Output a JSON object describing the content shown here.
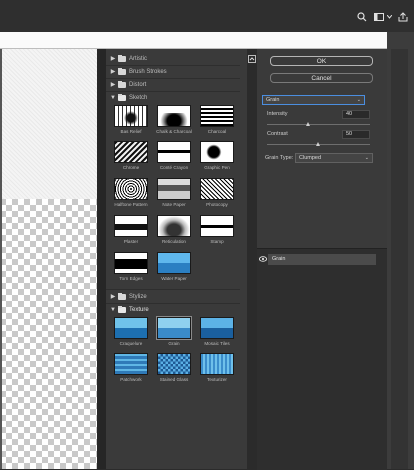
{
  "dialog": {
    "ok_label": "OK",
    "cancel_label": "Cancel",
    "texture_type_label": "Grain",
    "intensity_label": "Intensity",
    "intensity_value": "40",
    "contrast_label": "Contrast",
    "contrast_value": "50",
    "grain_type_label": "Grain Type:",
    "grain_type_value": "Clumped",
    "effect_layer_label": "Grain"
  },
  "categories": {
    "artistic": "Artistic",
    "brush_strokes": "Brush Strokes",
    "distort": "Distort",
    "sketch": "Sketch",
    "stylize": "Stylize",
    "texture": "Texture"
  },
  "sketch_filters": [
    "Bas Relief",
    "Chalk & Charcoal",
    "Charcoal",
    "Chrome",
    "Conté Crayon",
    "Graphic Pen",
    "Halftone Pattern",
    "Note Paper",
    "Photocopy",
    "Plaster",
    "Reticulation",
    "Stamp",
    "Torn Edges",
    "Water Paper"
  ],
  "texture_filters": [
    "Craquelure",
    "Grain",
    "Mosaic Tiles",
    "Patchwork",
    "Stained Glass",
    "Texturizer"
  ],
  "selected_filter": "Grain",
  "icons": {
    "top": [
      "search-icon",
      "workspace-icon",
      "share-icon"
    ]
  },
  "colors": {
    "panel_bg": "#3a3a3a",
    "app_bg": "#2b2b2b",
    "focus_blue": "#4b8ee0"
  }
}
